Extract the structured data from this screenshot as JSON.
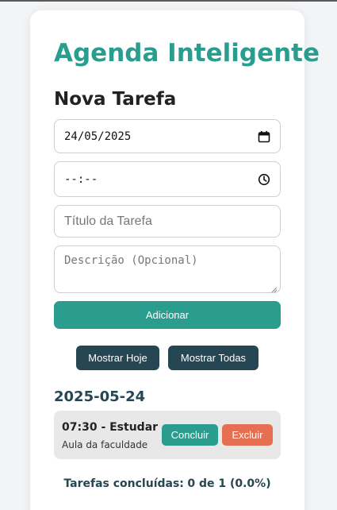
{
  "app": {
    "title": "Agenda Inteligente"
  },
  "form": {
    "heading": "Nova Tarefa",
    "date_value": "24/05/2025",
    "time_value": "--:--",
    "title_placeholder": "Título da Tarefa",
    "description_placeholder": "Descrição (Opcional)",
    "add_label": "Adicionar"
  },
  "filters": {
    "today_label": "Mostrar Hoje",
    "all_label": "Mostrar Todas"
  },
  "tasks_group": {
    "date": "2025-05-24",
    "items": [
      {
        "title": "07:30 - Estudar",
        "description": "Aula da faculdade",
        "conclude_label": "Concluir",
        "delete_label": "Excluir"
      }
    ]
  },
  "summary": {
    "label": "Tarefas concluídas:",
    "value": "0 de 1 (0.0%)"
  },
  "colors": {
    "accent": "#2a9d8f",
    "dark": "#264653",
    "danger": "#e76f51"
  },
  "icons": {
    "date": "calendar-icon",
    "time": "clock-icon"
  }
}
